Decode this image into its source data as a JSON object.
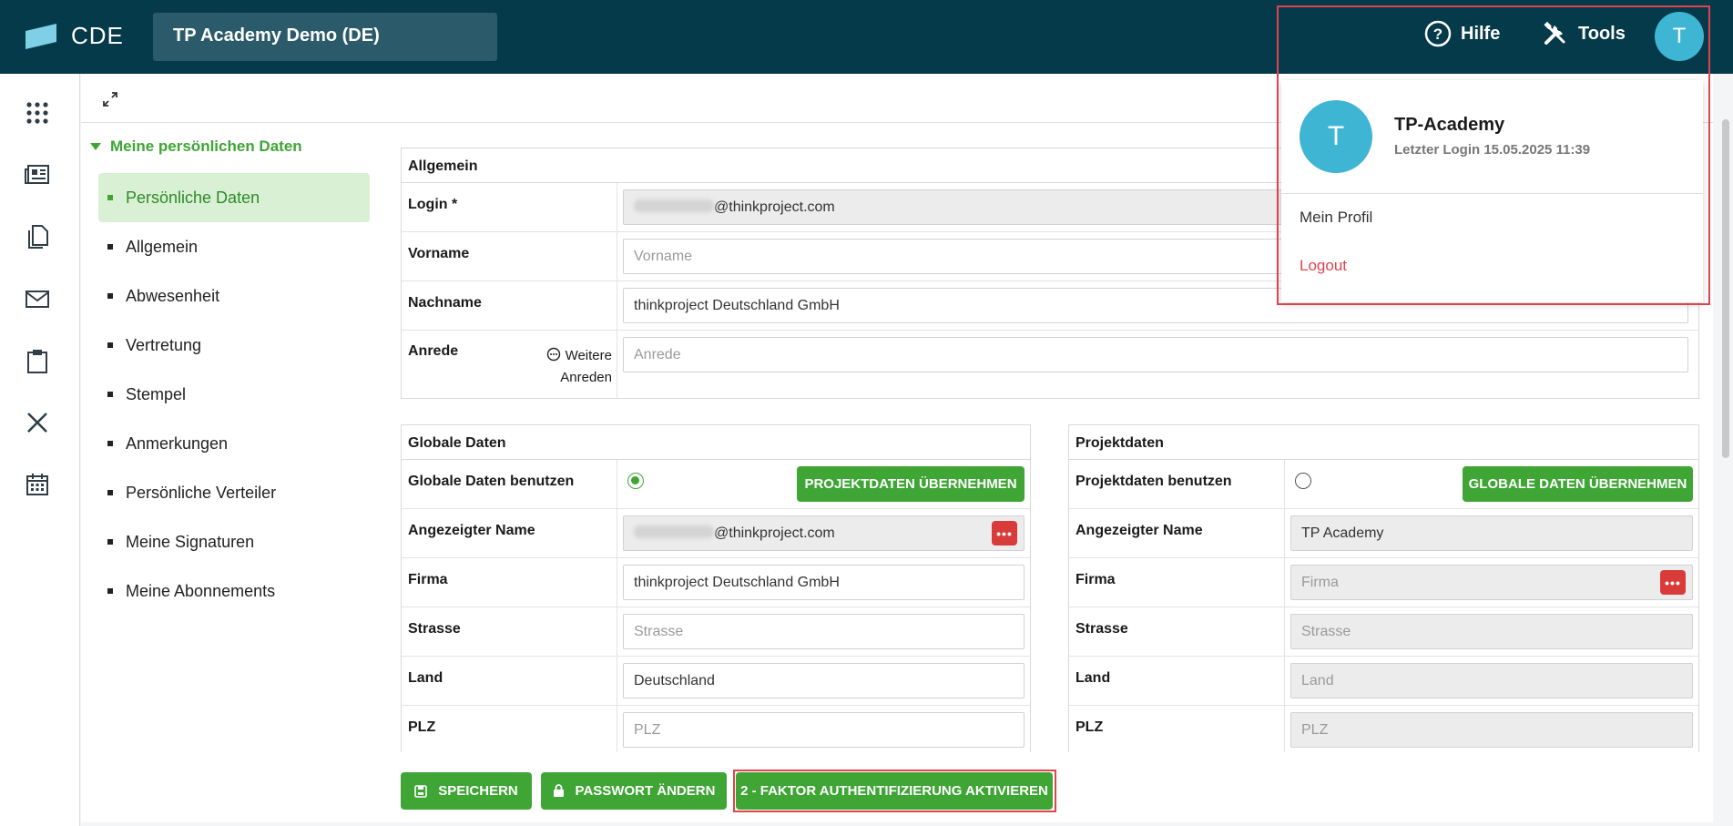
{
  "app": {
    "logo_text": "CDE",
    "project": "TP Academy Demo (DE)"
  },
  "topbar": {
    "help_label": "Hilfe",
    "tools_label": "Tools",
    "avatar_initial": "T"
  },
  "nav": {
    "heading": "Meine persönlichen Daten",
    "items": [
      {
        "label": "Persönliche Daten",
        "active": true
      },
      {
        "label": "Allgemein"
      },
      {
        "label": "Abwesenheit"
      },
      {
        "label": "Vertretung"
      },
      {
        "label": "Stempel"
      },
      {
        "label": "Anmerkungen"
      },
      {
        "label": "Persönliche Verteiler"
      },
      {
        "label": "Meine Signaturen"
      },
      {
        "label": "Meine Abonnements"
      }
    ]
  },
  "allgemein": {
    "title": "Allgemein",
    "login_label": "Login *",
    "login_value_suffix": "@thinkproject.com",
    "vorname_label": "Vorname",
    "vorname_placeholder": "Vorname",
    "nachname_label": "Nachname",
    "nachname_value": "thinkproject Deutschland GmbH",
    "anrede_label": "Anrede",
    "weitere_anreden": "Weitere Anreden",
    "anrede_placeholder": "Anrede"
  },
  "global": {
    "title": "Globale Daten",
    "use_label": "Globale Daten benutzen",
    "use_selected": true,
    "copy_button": "PROJEKTDATEN ÜBERNEHMEN",
    "name_label": "Angezeigter Name",
    "name_value_suffix": "@thinkproject.com",
    "firma_label": "Firma",
    "firma_value": "thinkproject Deutschland GmbH",
    "strasse_label": "Strasse",
    "strasse_placeholder": "Strasse",
    "land_label": "Land",
    "land_value": "Deutschland",
    "plz_label": "PLZ",
    "plz_placeholder": "PLZ"
  },
  "project": {
    "title": "Projektdaten",
    "use_label": "Projektdaten benutzen",
    "use_selected": false,
    "copy_button": "GLOBALE DATEN ÜBERNEHMEN",
    "name_label": "Angezeigter Name",
    "name_value": "TP Academy",
    "firma_label": "Firma",
    "firma_placeholder": "Firma",
    "strasse_label": "Strasse",
    "strasse_placeholder": "Strasse",
    "land_label": "Land",
    "land_placeholder": "Land",
    "plz_label": "PLZ",
    "plz_placeholder": "PLZ"
  },
  "actions": {
    "save": "SPEICHERN",
    "change_password": "PASSWORT ÄNDERN",
    "enable_2fa": "2 - FAKTOR AUTHENTIFIZIERUNG AKTIVIEREN"
  },
  "user_menu": {
    "initial": "T",
    "name": "TP-Academy",
    "last_login": "Letzter Login 15.05.2025 11:39",
    "profile": "Mein Profil",
    "logout": "Logout"
  },
  "colors": {
    "header": "#053a4a",
    "accent_green": "#3fa535",
    "avatar": "#3fb5d4",
    "logout_red": "#e0434e",
    "highlight": "#e0434e"
  }
}
